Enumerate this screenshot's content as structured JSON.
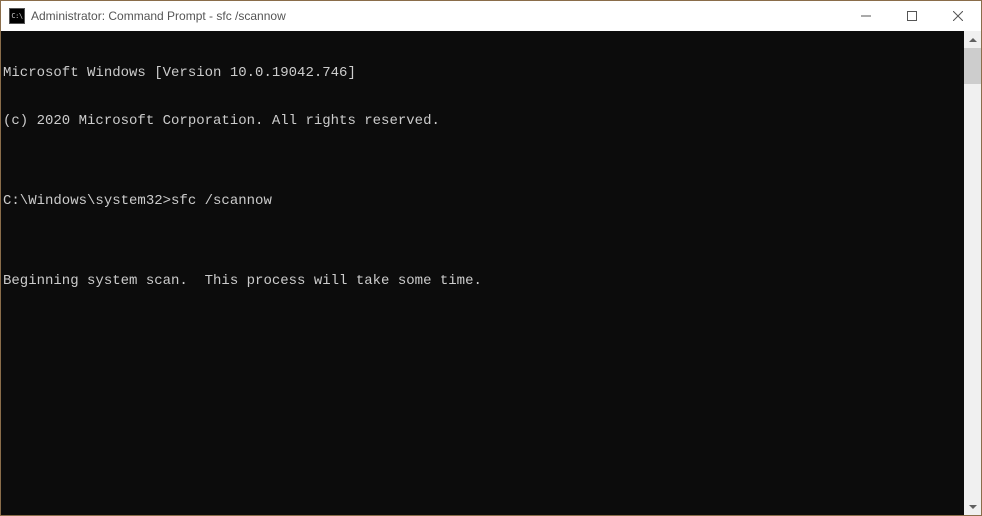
{
  "window": {
    "title": "Administrator: Command Prompt - sfc  /scannow",
    "icon_label": "C:\\"
  },
  "console": {
    "lines": [
      "Microsoft Windows [Version 10.0.19042.746]",
      "(c) 2020 Microsoft Corporation. All rights reserved.",
      "",
      "C:\\Windows\\system32>sfc /scannow",
      "",
      "Beginning system scan.  This process will take some time.",
      ""
    ],
    "prompt_prefix": "C:\\Windows\\system32>",
    "command_entered": "sfc /scannow"
  }
}
